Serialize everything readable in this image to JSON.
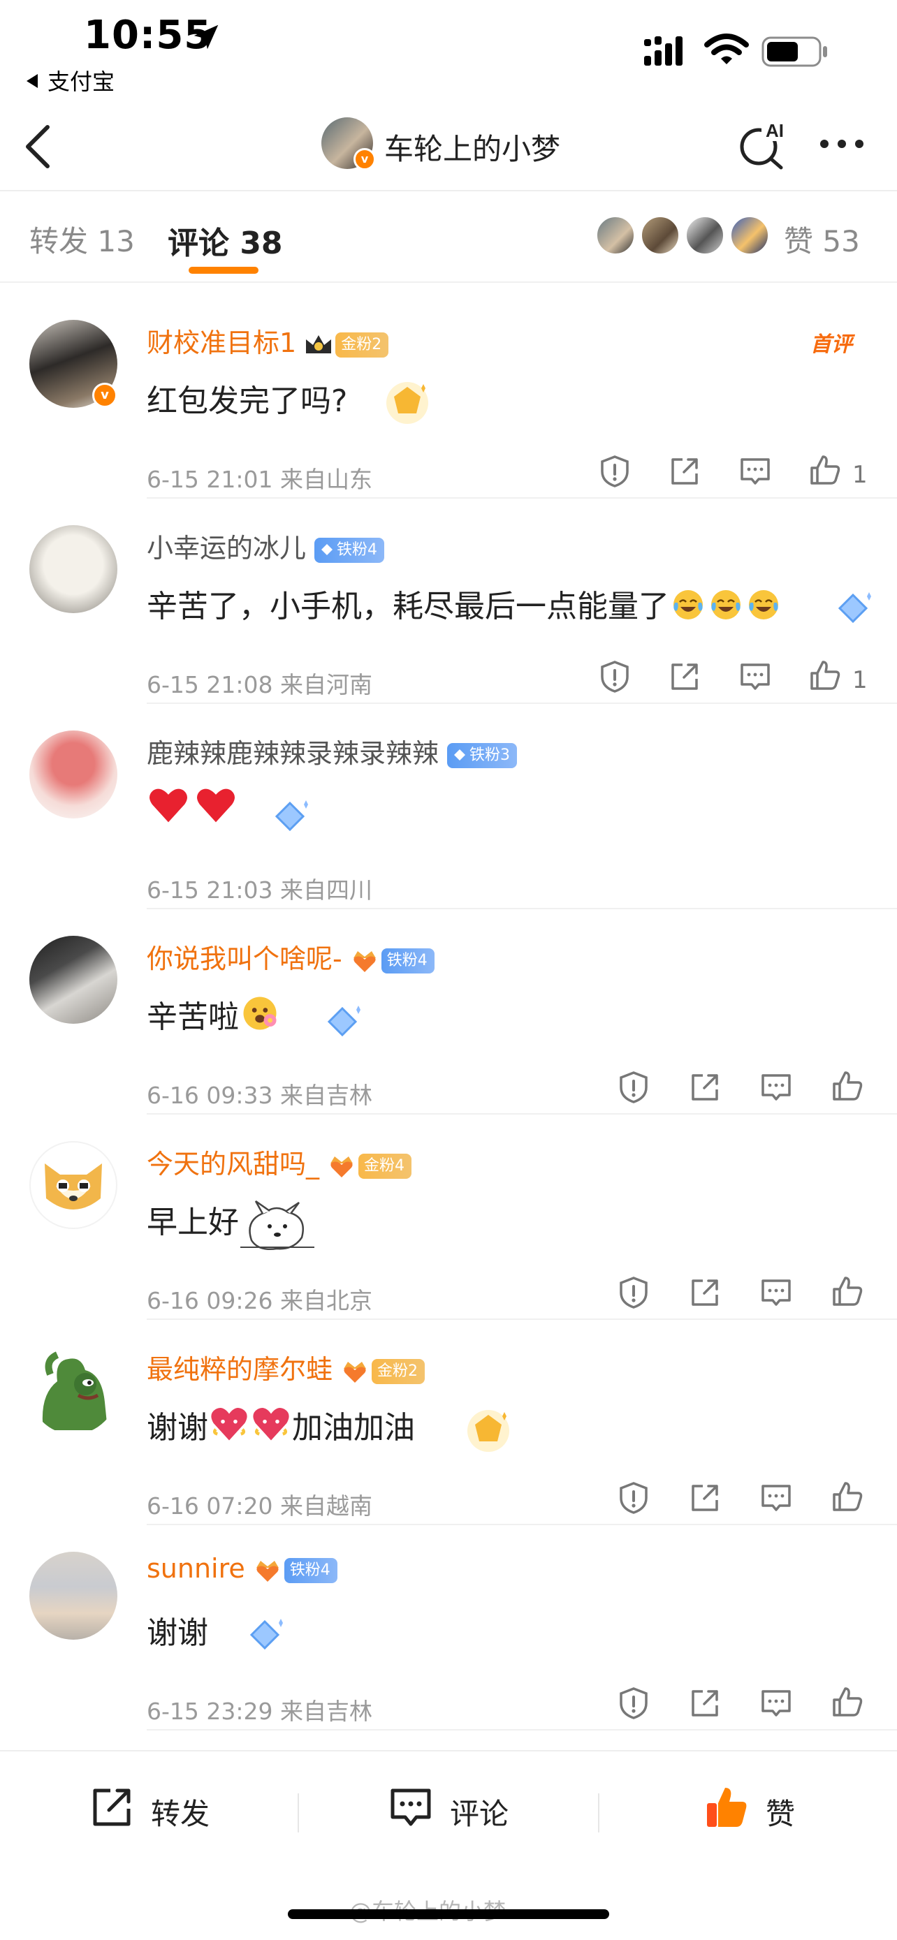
{
  "status_bar": {
    "time": "10:55",
    "back_app": "支付宝"
  },
  "nav": {
    "title": "车轮上的小梦",
    "ai_label": "AI"
  },
  "tabs": {
    "repost_label": "转发 13",
    "comment_label": "评论 38",
    "likes_label": "赞 53"
  },
  "comments": [
    {
      "name": "财校准目标1",
      "badge": "金粉2",
      "badge_type": "gold",
      "first_comment_label": "首评",
      "text": "红包发完了吗?",
      "meta": "6-15 21:01  来自山东",
      "likes": "1"
    },
    {
      "name": "小幸运的冰儿",
      "badge": "铁粉4",
      "badge_type": "iron",
      "text": "辛苦了，小手机，耗尽最后一点能量了",
      "meta": "6-15 21:08  来自河南",
      "likes": "1"
    },
    {
      "name": "鹿辣辣鹿辣辣录辣录辣辣",
      "badge": "铁粉3",
      "badge_type": "iron",
      "text": "",
      "meta": "6-15 21:03  来自四川"
    },
    {
      "name": "你说我叫个啥呢-",
      "badge": "铁粉4",
      "badge_type": "iron",
      "text": "辛苦啦",
      "meta": "6-16 09:33  来自吉林"
    },
    {
      "name": "今天的风甜吗_",
      "badge": "金粉4",
      "badge_type": "gold",
      "text": "早上好",
      "meta": "6-16 09:26  来自北京"
    },
    {
      "name": "最纯粹的摩尔蛙",
      "badge": "金粉2",
      "badge_type": "gold",
      "text_a": "谢谢",
      "text_b": "加油加油",
      "meta": "6-16 07:20  来自越南"
    },
    {
      "name": "sunnire",
      "badge": "铁粉4",
      "badge_type": "iron",
      "text": "谢谢",
      "meta": "6-15 23:29  来自吉林"
    }
  ],
  "bottom_bar": {
    "repost_label": "转发",
    "comment_label": "评论",
    "like_label": "赞"
  },
  "watermark": "@车轮上的小梦",
  "colors": {
    "accent": "#ff8200",
    "name_orange": "#f0720f",
    "meta_grey": "#9a9a9a"
  }
}
